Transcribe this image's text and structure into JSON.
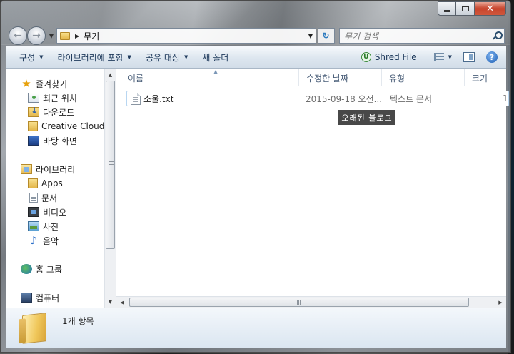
{
  "window": {
    "address_path": "무기",
    "search_placeholder": "무기 검색"
  },
  "command_bar": {
    "organize": "구성",
    "include_in_library": "라이브러리에 포함",
    "share_with": "공유 대상",
    "new_folder": "새 폴더",
    "shred_file": "Shred File"
  },
  "nav_pane": {
    "favorites": "즐겨찾기",
    "recent_places": "최근 위치",
    "downloads": "다운로드",
    "creative_cloud": "Creative Cloud F",
    "desktop": "바탕 화면",
    "libraries": "라이브러리",
    "apps": "Apps",
    "documents": "문서",
    "videos": "비디오",
    "pictures": "사진",
    "music": "음악",
    "homegroup": "홈 그룹",
    "computer": "컴퓨터"
  },
  "columns": {
    "name": "이름",
    "date_modified": "수정한 날짜",
    "type": "유형",
    "size": "크기"
  },
  "files": [
    {
      "name": "소울.txt",
      "date_modified": "2015-09-18 오전...",
      "type": "텍스트 문서",
      "size": "1"
    }
  ],
  "watermark": "오래된 블로그",
  "details_pane": {
    "item_count": "1개 항목"
  }
}
